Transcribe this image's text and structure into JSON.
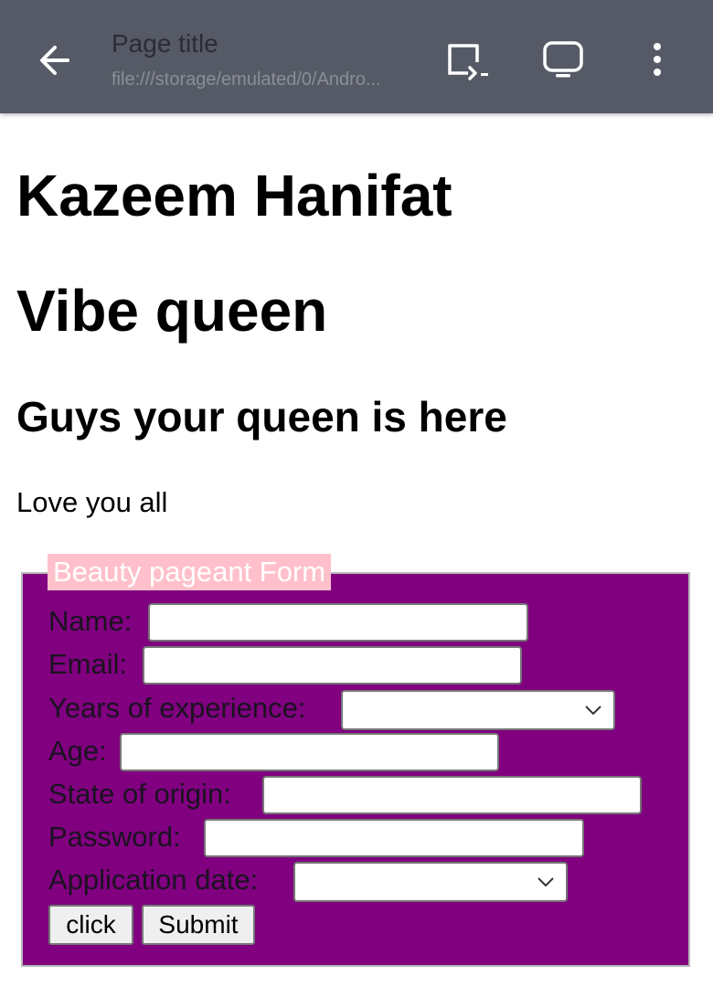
{
  "toolbar": {
    "page_title": "Page title",
    "url": "file:///storage/emulated/0/Andro..."
  },
  "icons": {
    "back": "arrow-left-icon",
    "cast": "cast-icon",
    "screen": "desktop-screen-icon",
    "menu": "more-vertical-icon"
  },
  "page": {
    "heading1": "Kazeem Hanifat",
    "heading2": "Vibe queen",
    "subheading": "Guys your queen is here",
    "paragraph": "Love you all"
  },
  "form": {
    "legend": "Beauty pageant Form",
    "fields": {
      "name_label": "Name:",
      "email_label": "Email:",
      "experience_label": "Years of experience:",
      "age_label": "Age:",
      "state_label": "State of origin:",
      "password_label": "Password:",
      "date_label": "Application date:"
    },
    "buttons": {
      "click": "click",
      "submit": "Submit"
    }
  },
  "colors": {
    "toolbar": "#555a66",
    "form_background": "#800080",
    "legend_background": "#ffc0cb",
    "legend_text": "#ffffff"
  }
}
